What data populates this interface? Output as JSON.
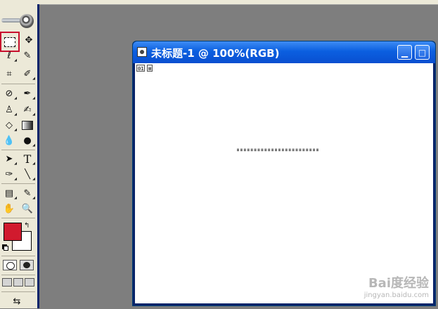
{
  "document": {
    "title": "未标题-1 @ 100%(RGB)",
    "badges": [
      "01",
      "⊠"
    ]
  },
  "toolbox": {
    "foreground_color": "#d11a2e",
    "background_color": "#ffffff",
    "tools": [
      {
        "name": "rectangular-marquee-tool",
        "icon": "marquee-icon",
        "selected": true
      },
      {
        "name": "move-tool",
        "icon": "move-icon"
      },
      {
        "name": "lasso-tool",
        "icon": "lasso-icon"
      },
      {
        "name": "magic-wand-tool",
        "icon": "magic-wand-icon"
      },
      {
        "name": "crop-tool",
        "icon": "crop-icon"
      },
      {
        "name": "slice-tool",
        "icon": "slice-icon"
      },
      {
        "name": "healing-brush-tool",
        "icon": "bandage-icon"
      },
      {
        "name": "brush-tool",
        "icon": "brush-icon"
      },
      {
        "name": "clone-stamp-tool",
        "icon": "stamp-icon"
      },
      {
        "name": "history-brush-tool",
        "icon": "history-brush-icon"
      },
      {
        "name": "eraser-tool",
        "icon": "eraser-icon"
      },
      {
        "name": "gradient-tool",
        "icon": "gradient-icon"
      },
      {
        "name": "blur-tool",
        "icon": "drop-icon"
      },
      {
        "name": "dodge-tool",
        "icon": "dodge-icon"
      },
      {
        "name": "path-selection-tool",
        "icon": "arrow-icon"
      },
      {
        "name": "type-tool",
        "icon": "type-icon",
        "glyph": "T"
      },
      {
        "name": "pen-tool",
        "icon": "pen-icon"
      },
      {
        "name": "line-tool",
        "icon": "line-icon"
      },
      {
        "name": "notes-tool",
        "icon": "notes-icon"
      },
      {
        "name": "eyedropper-tool",
        "icon": "eyedropper-icon"
      },
      {
        "name": "hand-tool",
        "icon": "hand-icon"
      },
      {
        "name": "zoom-tool",
        "icon": "magnifier-icon"
      }
    ]
  },
  "watermark": {
    "brand": "Bai度经验",
    "url": "jingyan.baidu.com"
  }
}
